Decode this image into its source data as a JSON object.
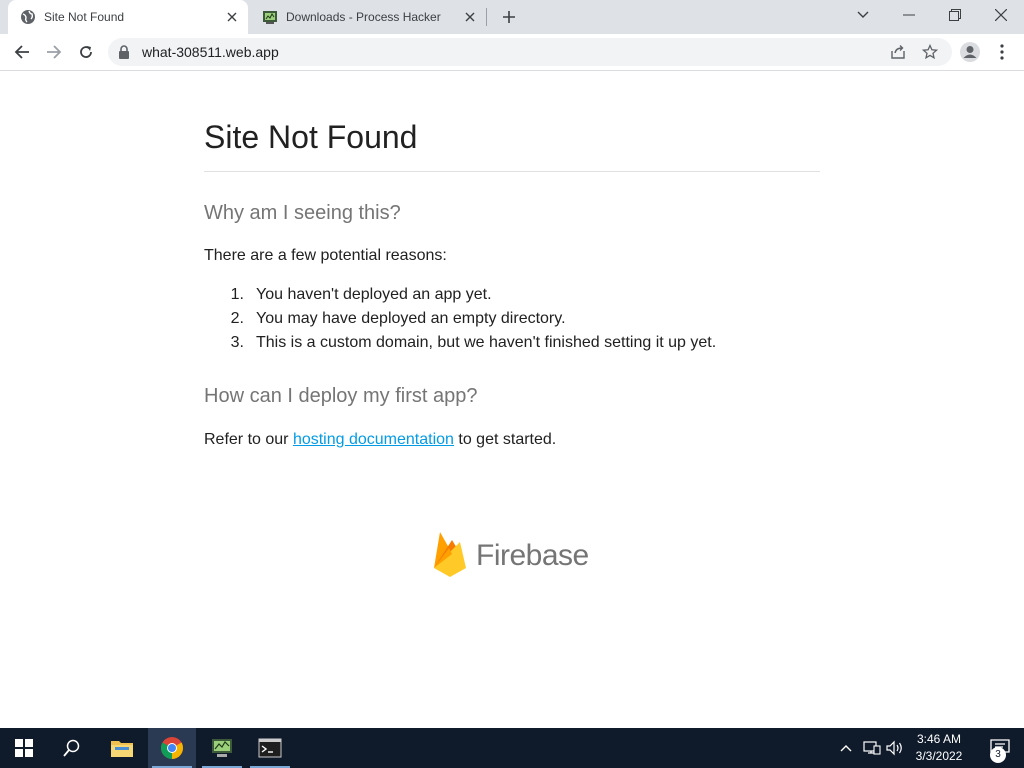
{
  "browser": {
    "tabs": [
      {
        "title": "Site Not Found",
        "icon": "globe-icon",
        "active": true
      },
      {
        "title": "Downloads - Process Hacker",
        "icon": "process-hacker-icon",
        "active": false
      }
    ],
    "url": "what-308511.web.app"
  },
  "page": {
    "title": "Site Not Found",
    "section1_heading": "Why am I seeing this?",
    "intro": "There are a few potential reasons:",
    "reasons": [
      {
        "num": "1.",
        "text": "You haven't deployed an app yet."
      },
      {
        "num": "2.",
        "text": "You may have deployed an empty directory."
      },
      {
        "num": "3.",
        "text": "This is a custom domain, but we haven't finished setting it up yet."
      }
    ],
    "section2_heading": "How can I deploy my first app?",
    "refer_prefix": "Refer to our",
    "refer_link": "hosting documentation",
    "refer_suffix": "to get started.",
    "brand": "Firebase"
  },
  "taskbar": {
    "time": "3:46 AM",
    "date": "3/3/2022",
    "notification_count": "3",
    "apps": [
      "windows-start-icon",
      "search-icon",
      "file-explorer-icon",
      "chrome-icon",
      "process-hacker-icon",
      "terminal-icon"
    ]
  },
  "colors": {
    "link": "#039be5",
    "heading_gray": "#757575",
    "taskbar_bg": "#0f1a2a",
    "tabstrip_bg": "#dee1e6"
  }
}
